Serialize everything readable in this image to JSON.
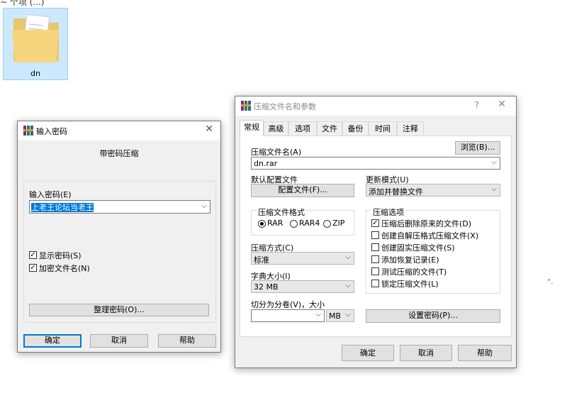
{
  "desktop": {
    "top_crop_text": "~ 个项 (...)",
    "folder_label": "dn"
  },
  "password_dialog": {
    "title": "输入密码",
    "header": "带密码压缩",
    "password_label": "输入密码(E)",
    "password_value": "上老王论坛当老王",
    "show_password": "显示密码(S)",
    "encrypt_names": "加密文件名(N)",
    "organize_button": "整理密码(O)...",
    "ok": "确定",
    "cancel": "取消",
    "help": "帮助",
    "close": "✕"
  },
  "archive_dialog": {
    "title": "压缩文件名和参数",
    "question": "?",
    "close": "✕",
    "tabs": [
      "常规",
      "高级",
      "选项",
      "文件",
      "备份",
      "时间",
      "注释"
    ],
    "archive_name_label": "压缩文件名(A)",
    "browse_button": "浏览(B)...",
    "archive_name_value": "dn.rar",
    "default_profile_label": "默认配置文件",
    "profile_button": "配置文件(F)...",
    "update_mode_label": "更新模式(U)",
    "update_mode_value": "添加并替换文件",
    "format_label": "压缩文件格式",
    "formats": [
      "RAR",
      "RAR4",
      "ZIP"
    ],
    "options_label": "压缩选项",
    "options": [
      {
        "label": "压缩后删除原来的文件(D)",
        "checked": true
      },
      {
        "label": "创建自解压格式压缩文件(X)",
        "checked": false
      },
      {
        "label": "创建固实压缩文件(S)",
        "checked": false
      },
      {
        "label": "添加恢复记录(E)",
        "checked": false
      },
      {
        "label": "测试压缩的文件(T)",
        "checked": false
      },
      {
        "label": "锁定压缩文件(L)",
        "checked": false
      }
    ],
    "method_label": "压缩方式(C)",
    "method_value": "标准",
    "dict_label": "字典大小(I)",
    "dict_value": "32 MB",
    "split_label": "切分为分卷(V)，大小",
    "split_unit": "MB",
    "set_password_button": "设置密码(P)...",
    "ok": "确定",
    "cancel": "取消",
    "help": "帮助"
  },
  "stray_mark": "⁺."
}
